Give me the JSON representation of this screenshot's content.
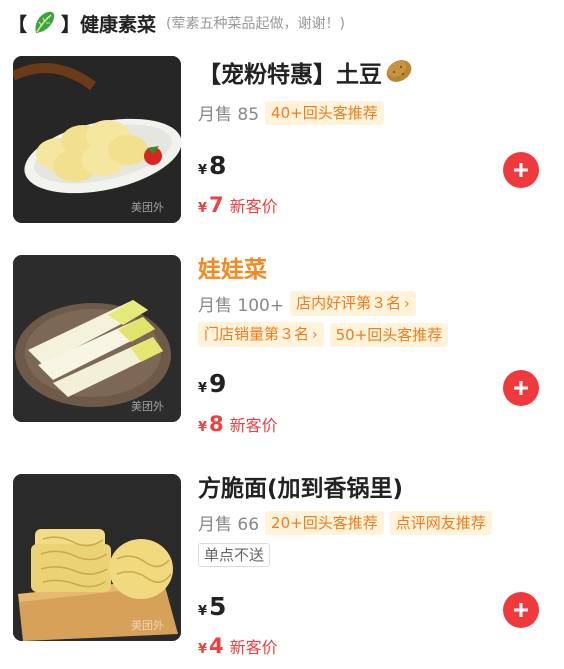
{
  "section": {
    "open_bracket": "【",
    "close_bracket": "】",
    "icon": "lettuce-icon",
    "title": "健康素菜",
    "note": "(荤素五种菜品起做，谢谢！)"
  },
  "items": [
    {
      "name": "【宠粉特惠】土豆",
      "name_icon": "potato-icon",
      "sales": "月售 85",
      "tags": [
        "40+回头客推荐"
      ],
      "price_symbol": "¥",
      "price": "8",
      "new_price": "7",
      "new_price_label": "新客价",
      "watermark": "美团外"
    },
    {
      "name": "娃娃菜",
      "sales": "月售 100+",
      "tags": [
        "店内好评第３名",
        "门店销量第３名",
        "50+回头客推荐"
      ],
      "price_symbol": "¥",
      "price": "9",
      "new_price": "8",
      "new_price_label": "新客价",
      "watermark": "美团外"
    },
    {
      "name": "方脆面(加到香锅里)",
      "sales": "月售 66",
      "tags": [
        "20+回头客推荐",
        "点评网友推荐"
      ],
      "restriction": "单点不送",
      "price_symbol": "¥",
      "price": "5",
      "new_price": "4",
      "new_price_label": "新客价",
      "watermark": "美团外"
    }
  ],
  "colors": {
    "accent_red": "#f0393d",
    "tag_orange": "#f07c1a",
    "tag_bg": "#fff3dc",
    "new_price_red": "#ef4040",
    "highlight_name": "#f5891f"
  }
}
